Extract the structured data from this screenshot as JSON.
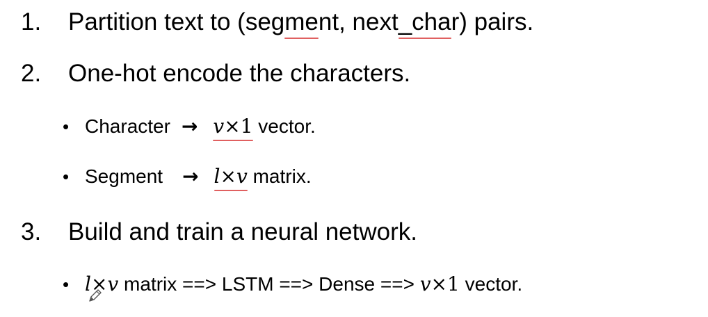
{
  "steps": [
    {
      "number": "1.",
      "parts": [
        "Partition text to (seg",
        "me",
        "nt, next",
        "_cha",
        "r) pairs."
      ]
    },
    {
      "number": "2.",
      "text": "One-hot encode the characters.",
      "bullets": [
        {
          "bullet": "•",
          "label": "Character",
          "arrow": "→",
          "math_a": "v",
          "math_op": "×",
          "math_b": "1",
          "rest": " vector."
        },
        {
          "bullet": "•",
          "label": "Segment",
          "arrow": "→",
          "math_a": "l",
          "math_op": "×",
          "math_b": "v",
          "rest": " matrix."
        }
      ]
    },
    {
      "number": "3.",
      "text": "Build and train a neural network.",
      "bullets": [
        {
          "bullet": "•",
          "math_a": "l",
          "math_op": "×",
          "math_b": "v",
          "mid": " matrix ==> LSTM ==> Dense ==> ",
          "math_c": "v",
          "math_op2": "×",
          "math_d": "1",
          "rest": " vector."
        }
      ]
    }
  ],
  "colors": {
    "text": "#000000",
    "spellcheck_underline": "#e06060",
    "background": "#ffffff"
  },
  "cursor_icon": "pen-cursor-icon"
}
